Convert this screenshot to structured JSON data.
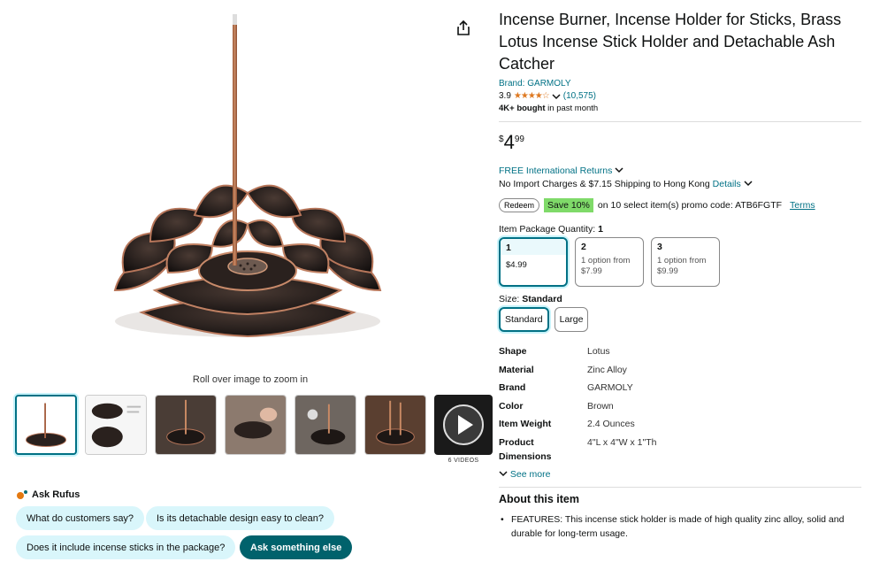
{
  "gallery": {
    "zoom_hint": "Roll over image to zoom in",
    "video_count_label": "6 VIDEOS",
    "share_icon": "share-icon"
  },
  "rufus": {
    "label": "Ask Rufus",
    "chips": [
      "What do customers say?",
      "Is its detachable design easy to clean?",
      "Does it include incense sticks in the package?",
      "Ask something else"
    ]
  },
  "product": {
    "title": "Incense Burner, Incense Holder for Sticks, Brass Lotus Incense Stick Holder and Detachable Ash Catcher",
    "brand_link": "Brand: GARMOLY",
    "rating": "3.9",
    "stars": "★★★★☆",
    "review_count": "(10,575)",
    "bought_bold": "4K+ bought",
    "bought_rest": " in past month",
    "price_symbol": "$",
    "price_whole": "4",
    "price_fraction": "99",
    "returns": "FREE International Returns",
    "import_text": "No Import Charges & $7.15 Shipping to Hong Kong",
    "details_link": "Details",
    "redeem": "Redeem",
    "save_badge": "Save 10%",
    "promo_text": "on 10 select item(s) promo code: ATB6FGTF",
    "terms": "Terms",
    "accent_color": "#007185"
  },
  "quantity": {
    "label": "Item Package Quantity: ",
    "selected": "1",
    "options": [
      {
        "n": "1",
        "sub": "$4.99"
      },
      {
        "n": "2",
        "sub": "1 option from",
        "price": "$7.99"
      },
      {
        "n": "3",
        "sub": "1 option from",
        "price": "$9.99"
      }
    ]
  },
  "size": {
    "label": "Size: ",
    "selected": "Standard",
    "options": [
      "Standard",
      "Large"
    ]
  },
  "specs": [
    {
      "k": "Shape",
      "v": "Lotus"
    },
    {
      "k": "Material",
      "v": "Zinc Alloy"
    },
    {
      "k": "Brand",
      "v": "GARMOLY"
    },
    {
      "k": "Color",
      "v": "Brown"
    },
    {
      "k": "Item Weight",
      "v": "2.4 Ounces"
    },
    {
      "k": "Product",
      "k2": "Dimensions",
      "v": "4\"L x 4\"W x 1\"Th"
    }
  ],
  "see_more": "See more",
  "about": {
    "heading": "About this item",
    "bullet": "FEATURES: This incense stick holder is made of high quality zinc alloy, solid and durable for long-term usage."
  }
}
